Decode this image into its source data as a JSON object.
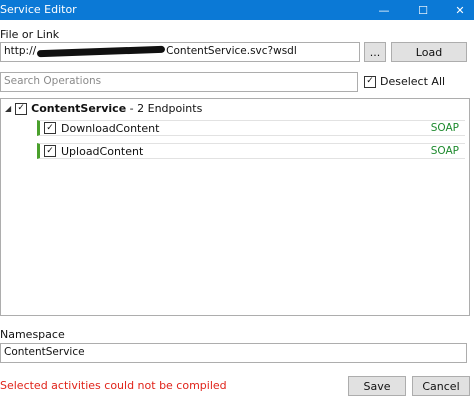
{
  "window": {
    "title": "Service Editor",
    "minimize_glyph": "—",
    "maximize_glyph": "☐",
    "close_glyph": "✕"
  },
  "source": {
    "label": "File or Link",
    "url_prefix": "http://",
    "url_suffix": "ContentService.svc?wsdl",
    "browse_label": "...",
    "load_label": "Load"
  },
  "search": {
    "placeholder": "Search Operations",
    "deselect_label": "Deselect All",
    "deselect_checked": true
  },
  "tree": {
    "root": {
      "name": "ContentService",
      "detail": " - 2 Endpoints",
      "checked": true,
      "expander_glyph": "◢"
    },
    "operations": [
      {
        "name": "DownloadContent",
        "binding": "SOAP",
        "checked": true
      },
      {
        "name": "UploadContent",
        "binding": "SOAP",
        "checked": true
      }
    ]
  },
  "namespace": {
    "label": "Namespace",
    "value": "ContentService"
  },
  "status": {
    "message": "Selected activities could not be compiled",
    "color": "#e0231a"
  },
  "footer": {
    "save_label": "Save",
    "cancel_label": "Cancel"
  },
  "colors": {
    "titlebar": "#0b79d6",
    "accent_green": "#4aa02c"
  },
  "check_glyph": "✓"
}
